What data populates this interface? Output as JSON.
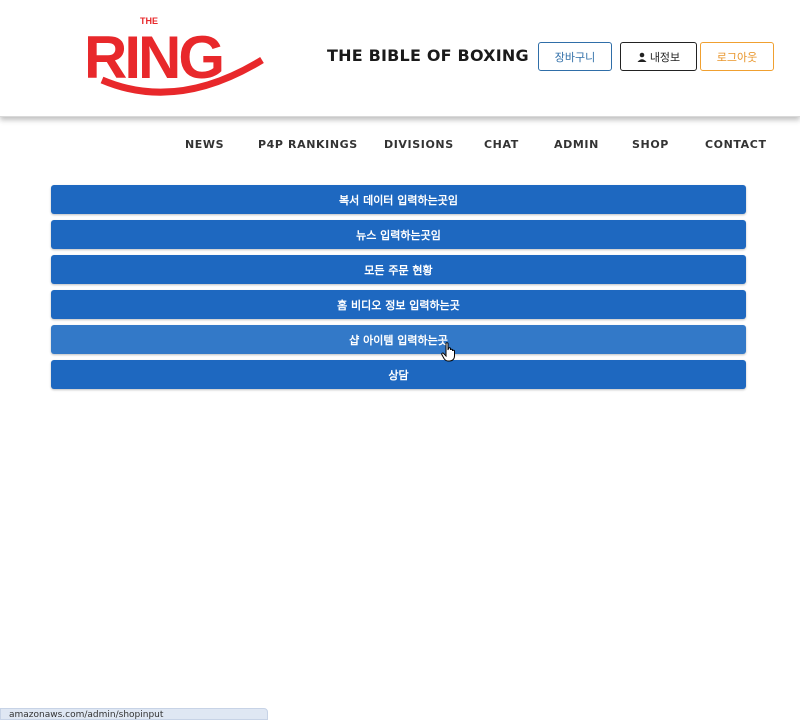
{
  "header": {
    "logo_text": "THE RING",
    "tagline": "THE BIBLE OF BOXING",
    "buttons": {
      "cart": "장바구니",
      "profile": "내정보",
      "logout": "로그아웃"
    }
  },
  "nav": {
    "items": [
      "NEWS",
      "P4P RANKINGS",
      "DIVISIONS",
      "CHAT",
      "ADMIN",
      "SHOP",
      "CONTACT"
    ]
  },
  "admin_menu": {
    "items": [
      "복서 데이터 입력하는곳임",
      "뉴스 입력하는곳임",
      "모든 주문 현황",
      "홈 비디오 정보 입력하는곳",
      "샵 아이템 입력하는곳",
      "상담"
    ]
  },
  "status_bar": {
    "url": "amazonaws.com/admin/shopinput"
  },
  "colors": {
    "menu_button": "#1e68c0",
    "logo_red": "#e8282b",
    "cart_border": "#2f6ea8",
    "logout_border": "#f0a030"
  },
  "icons": {
    "profile": "person-icon",
    "cursor": "hand-pointer-icon"
  }
}
